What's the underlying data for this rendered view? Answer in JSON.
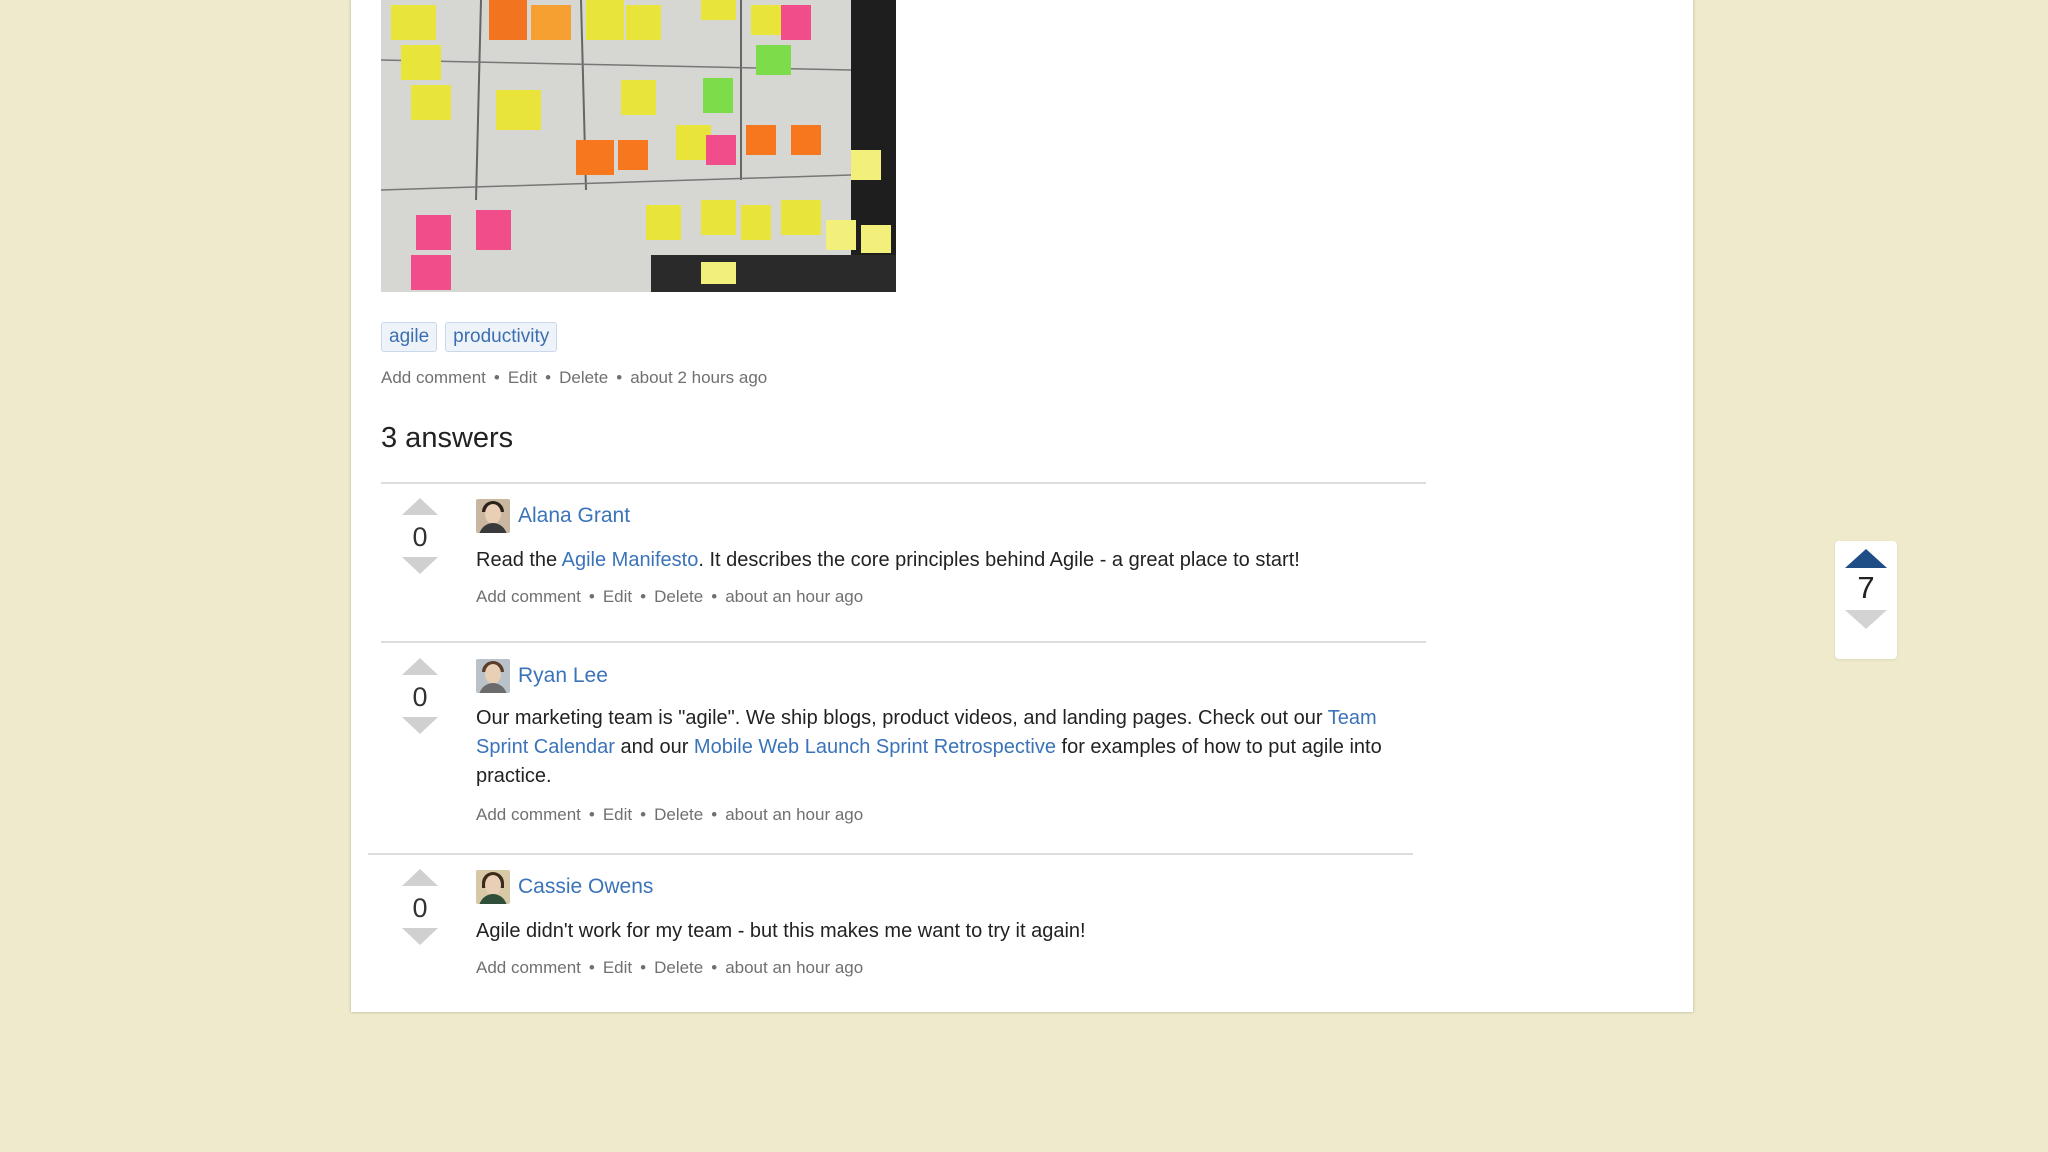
{
  "question": {
    "image_alt": "Whiteboard covered with sticky notes",
    "tags": [
      "agile",
      "productivity"
    ],
    "actions": {
      "add_comment": "Add comment",
      "edit": "Edit",
      "delete": "Delete"
    },
    "timestamp": "about 2 hours ago",
    "vote_total": "7"
  },
  "answers_heading": "3 answers",
  "answers": [
    {
      "author": "Alana Grant",
      "votes": "0",
      "text_before_link": "Read the ",
      "link": "Agile Manifesto",
      "text_after_link": ". It describes the core principles behind Agile - a great place to start!",
      "actions": {
        "add_comment": "Add comment",
        "edit": "Edit",
        "delete": "Delete"
      },
      "timestamp": "about an hour ago"
    },
    {
      "author": "Ryan Lee",
      "votes": "0",
      "text_part1": "Our marketing team is \"agile\". We ship blogs, product videos, and landing pages. Check out our ",
      "link1": "Team Sprint Calendar",
      "text_part2": " and our ",
      "link2": "Mobile Web Launch Sprint Retrospective",
      "text_part3": " for examples of how to put agile into practice.",
      "actions": {
        "add_comment": "Add comment",
        "edit": "Edit",
        "delete": "Delete"
      },
      "timestamp": "about an hour ago"
    },
    {
      "author": "Cassie Owens",
      "votes": "0",
      "text": "Agile didn't work for my team - but this makes me want to try it again!",
      "actions": {
        "add_comment": "Add comment",
        "edit": "Edit",
        "delete": "Delete"
      },
      "timestamp": "about an hour ago"
    }
  ],
  "colors": {
    "background": "#eeeacb",
    "link": "#3b73b9",
    "upvote_active": "#1f4d86",
    "vote_inactive": "#d0d0d0"
  }
}
